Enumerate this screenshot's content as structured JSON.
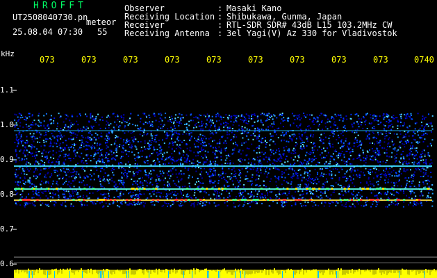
{
  "app": {
    "title": "HROFFT"
  },
  "file": {
    "name": "UT2508040730.pn",
    "suffix": "meteor",
    "datetime": "25.08.04 07:30",
    "count": "55"
  },
  "info": [
    {
      "label": "Observer",
      "value": "Masaki Kano"
    },
    {
      "label": "Receiving Location",
      "value": "Shibukawa, Gunma, Japan"
    },
    {
      "label": "Receiver",
      "value": "RTL-SDR SDR# 43dB L15 103.2MHz CW"
    },
    {
      "label": "Receiving Antenna",
      "value": "3el Yagi(V) Az 330 for Vladivostok"
    }
  ],
  "axis": {
    "unit": "kHz",
    "time_labels": [
      "073",
      "073",
      "073",
      "073",
      "073",
      "073",
      "073",
      "073",
      "073",
      "0740"
    ],
    "freq_labels": [
      "1.1",
      "1.0",
      "0.9",
      "0.8",
      "0.7",
      "0.6"
    ]
  },
  "colors": {
    "title": "#00ff66",
    "time_labels": "#ffff00",
    "spectrum_low": "#0000c8",
    "spectrum_high": "#ff0000",
    "baseline": "#ffff00"
  }
}
